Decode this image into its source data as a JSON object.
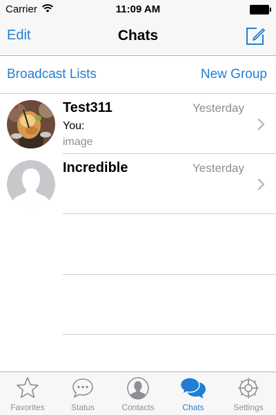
{
  "status_bar": {
    "carrier": "Carrier",
    "time": "11:09 AM"
  },
  "nav": {
    "edit_label": "Edit",
    "title": "Chats"
  },
  "list_header": {
    "broadcast_label": "Broadcast Lists",
    "new_group_label": "New Group"
  },
  "chats": [
    {
      "name": "Test311",
      "time": "Yesterday",
      "line1": "You:",
      "line2": "image",
      "avatar": "drink-photo"
    },
    {
      "name": "Incredible",
      "time": "Yesterday",
      "line1": "",
      "line2": "",
      "avatar": "default-silhouette"
    }
  ],
  "tabs": [
    {
      "label": "Favorites",
      "icon": "star-icon",
      "active": false
    },
    {
      "label": "Status",
      "icon": "speech-bubble-icon",
      "active": false
    },
    {
      "label": "Contacts",
      "icon": "person-icon",
      "active": false
    },
    {
      "label": "Chats",
      "icon": "chat-bubbles-icon",
      "active": true
    },
    {
      "label": "Settings",
      "icon": "gear-icon",
      "active": false
    }
  ],
  "colors": {
    "accent": "#1f7fd4",
    "secondary_text": "#8e8e93",
    "bar_background": "#f7f7f7",
    "separator": "#cfcfcf"
  }
}
